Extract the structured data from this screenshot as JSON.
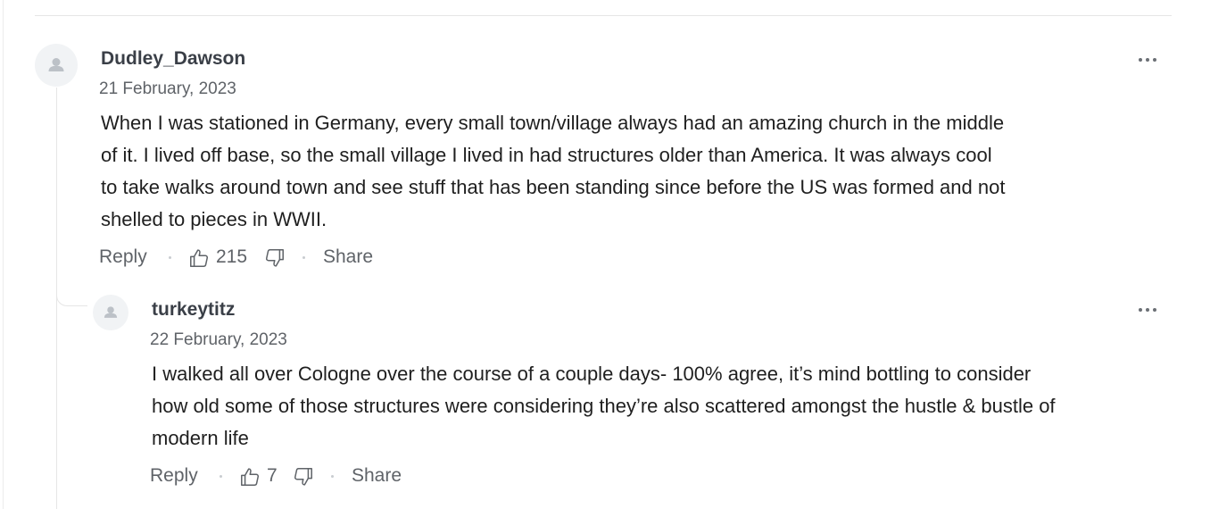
{
  "comments": [
    {
      "username": "Dudley_Dawson",
      "date": "21 February, 2023",
      "body_lines": [
        "When I was stationed in Germany, every small town/village always had an amazing church in the middle",
        "of it.  I lived off base, so the small village I lived in had structures older than America.  It was always cool",
        "to take walks around town and see stuff that has been standing since before the US was formed and not",
        "shelled to pieces in WWII."
      ],
      "reply_label": "Reply",
      "likes": "215",
      "share_label": "Share"
    },
    {
      "username": "turkeytitz",
      "date": "22 February, 2023",
      "body_lines": [
        "I walked all over Cologne over the course of a couple days- 100% agree, it’s mind bottling to consider",
        "how old some of those structures were considering they’re also scattered amongst the hustle & bustle of",
        "modern life"
      ],
      "reply_label": "Reply",
      "likes": "7",
      "share_label": "Share"
    }
  ],
  "icons": {
    "avatar": "default-user-avatar-icon",
    "more": "more-options-icon",
    "like": "thumbs-up-icon",
    "dislike": "thumbs-down-icon"
  },
  "colors": {
    "username": "#3a3f47",
    "meta": "#5f6368",
    "divider": "#e6e6e6",
    "avatar_bg": "#f1f3f5"
  }
}
